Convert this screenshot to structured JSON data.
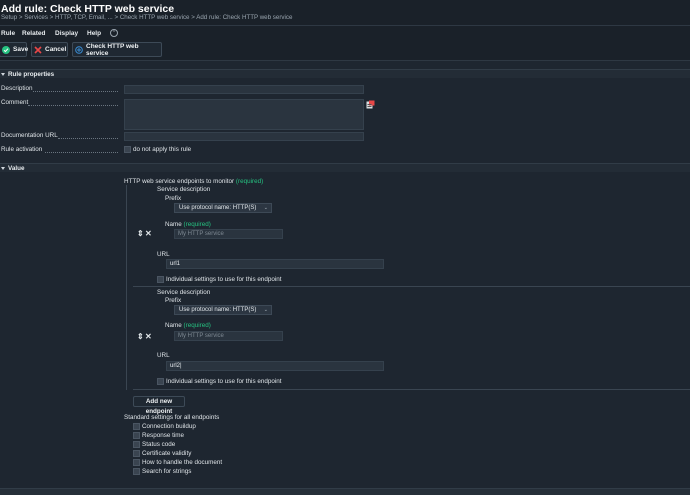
{
  "header": {
    "title": "Add rule: Check HTTP web service",
    "breadcrumb": "Setup > Services > HTTP, TCP, Email, ... > Check HTTP web service > Add rule: Check HTTP web service"
  },
  "menu": {
    "items": [
      "Rule",
      "Related",
      "Display",
      "Help"
    ],
    "collapse_icon": "chevron-up-icon"
  },
  "toolbar": {
    "save_label": "Save",
    "cancel_label": "Cancel",
    "check_label": "Check HTTP web service"
  },
  "rule_properties": {
    "heading": "Rule properties",
    "description_label": "Description",
    "description_value": "",
    "comment_label": "Comment",
    "comment_value": "",
    "documentation_label": "Documentation URL",
    "documentation_value": "",
    "activation_label": "Rule activation",
    "activation_checkbox_label": "do not apply this rule"
  },
  "value": {
    "heading": "Value",
    "endpoints_label": "HTTP web service endpoints to monitor",
    "required_text": "(required)",
    "endpoints": [
      {
        "service_description_label": "Service description",
        "prefix_label": "Prefix",
        "prefix_value": "Use protocol name: HTTP(S)",
        "name_label": "Name",
        "name_required": "(required)",
        "name_placeholder": "My HTTP service",
        "url_label": "URL",
        "url_value": "url1",
        "individual_label": "Individual settings to use for this endpoint"
      },
      {
        "service_description_label": "Service description",
        "prefix_label": "Prefix",
        "prefix_value": "Use protocol name: HTTP(S)",
        "name_label": "Name",
        "name_required": "(required)",
        "name_placeholder": "My HTTP service",
        "url_label": "URL",
        "url_value": "url2|",
        "individual_label": "Individual settings to use for this endpoint"
      }
    ],
    "add_endpoint_label": "Add new endpoint",
    "standard_settings_label": "Standard settings for all endpoints",
    "standard_settings": [
      "Connection buildup",
      "Response time",
      "Status code",
      "Certificate validity",
      "How to handle the document",
      "Search for strings"
    ]
  },
  "colors": {
    "background": "#1e2630",
    "required_green": "#26c281",
    "save_green": "#26c281",
    "cancel_red": "#e84747",
    "check_blue": "#3a8fd8"
  }
}
